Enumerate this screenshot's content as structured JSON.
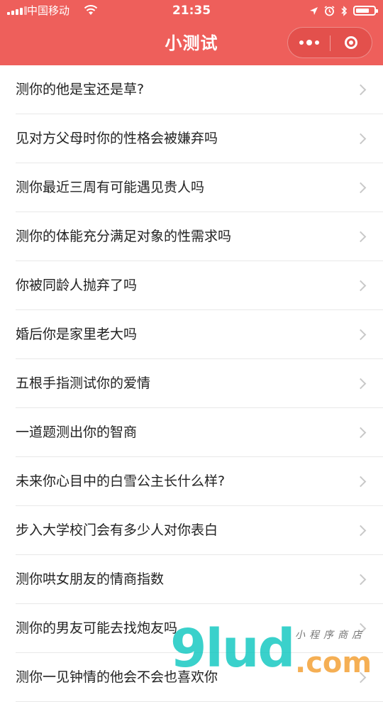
{
  "status_bar": {
    "carrier": "中国移动",
    "time": "21:35"
  },
  "header": {
    "title": "小测试"
  },
  "quiz_list": [
    "测你的他是宝还是草?",
    "见对方父母时你的性格会被嫌弃吗",
    "测你最近三周有可能遇见贵人吗",
    "测你的体能充分满足对象的性需求吗",
    "你被同龄人抛弃了吗",
    "婚后你是家里老大吗",
    "五根手指测试你的爱情",
    "一道题测出你的智商",
    "未来你心目中的白雪公主长什么样?",
    "步入大学校门会有多少人对你表白",
    "测你哄女朋友的情商指数",
    "测你的男友可能去找炮友吗",
    "测你一见钟情的他会不会也喜欢你"
  ],
  "watermark": {
    "logo": "9lud",
    "tld": ".com",
    "tagline": "小程序商店"
  },
  "colors": {
    "header_bg": "#ee5f5b",
    "text": "#222222",
    "divider": "#e8e8e8"
  },
  "icons": {
    "signal": "signal-bars-icon",
    "wifi": "wifi-icon",
    "location": "location-arrow-icon",
    "alarm": "alarm-clock-icon",
    "bluetooth": "bluetooth-icon",
    "battery": "battery-icon",
    "more": "more-dots-icon",
    "close": "close-ring-icon",
    "chevron": "chevron-right-icon"
  }
}
